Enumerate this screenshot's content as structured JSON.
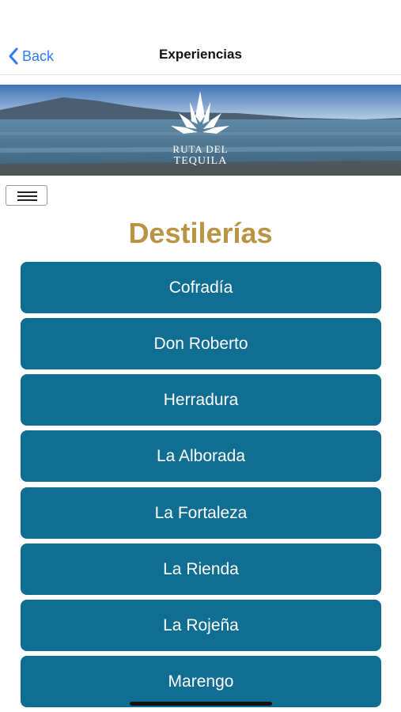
{
  "nav": {
    "back_label": "Back",
    "title": "Experiencias"
  },
  "banner": {
    "logo_line1": "RUTA DEL",
    "logo_line2": "TEQUILA"
  },
  "menu_icon": "hamburger-icon",
  "page_title": "Destilerías",
  "distilleries": [
    {
      "label": "Cofradía"
    },
    {
      "label": "Don Roberto"
    },
    {
      "label": "Herradura"
    },
    {
      "label": "La Alborada"
    },
    {
      "label": "La Fortaleza"
    },
    {
      "label": "La Rienda"
    },
    {
      "label": "La Rojeña"
    },
    {
      "label": "Marengo"
    }
  ],
  "colors": {
    "accent_blue": "#2f7bf5",
    "button_teal": "#0f6e92",
    "title_gold": "#b99443"
  }
}
